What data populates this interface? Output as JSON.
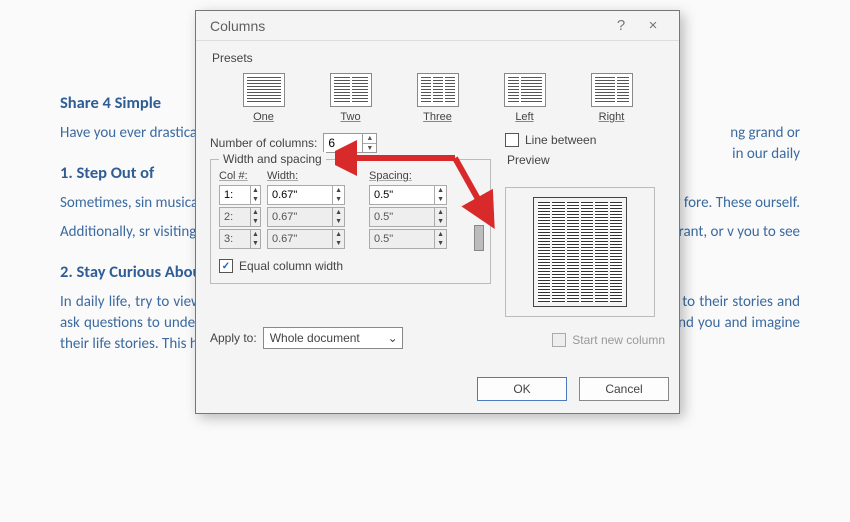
{
  "document": {
    "heading1": "Share 4 Simple",
    "para1": "Have you ever drastically diffe lives, you can n",
    "heading2": "1. Step Out of",
    "para2": "Sometimes, sin musical instrun activities not o",
    "para2b": "learn a new fore. These ourself.",
    "para3": "Additionally, sr visiting a muse the world arou",
    "para3b": "staurant, or v you to see",
    "heading3": "2. Stay Curious About Everything",
    "para4": "In daily life, try to view things around you with a sense of curiosity. When talking to someone, listen to their stories and ask questions to understand them better. Or, when sitting in a café or park, observe the people around you and imagine their life stories. This helps you develop empathy and find interest in things that might seem ordinary.",
    "frag_grand": "ng grand or",
    "frag_daily": "in our daily"
  },
  "dialog": {
    "title": "Columns",
    "help": "?",
    "close": "×",
    "presets_label": "Presets",
    "presets": {
      "one": "One",
      "two": "Two",
      "three": "Three",
      "left": "Left",
      "right": "Right"
    },
    "num_columns_label": "Number of columns:",
    "num_columns_value": "6",
    "line_between": "Line between",
    "width_spacing_legend": "Width and spacing",
    "headers": {
      "col": "Col #:",
      "width": "Width:",
      "spacing": "Spacing:"
    },
    "rows": [
      {
        "col": "1:",
        "width": "0.67\"",
        "spacing": "0.5\""
      },
      {
        "col": "2:",
        "width": "0.67\"",
        "spacing": "0.5\""
      },
      {
        "col": "3:",
        "width": "0.67\"",
        "spacing": "0.5\""
      }
    ],
    "equal_width": "Equal column width",
    "preview_label": "Preview",
    "apply_to_label": "Apply to:",
    "apply_to_value": "Whole document",
    "start_new_col": "Start new column",
    "ok": "OK",
    "cancel": "Cancel"
  }
}
